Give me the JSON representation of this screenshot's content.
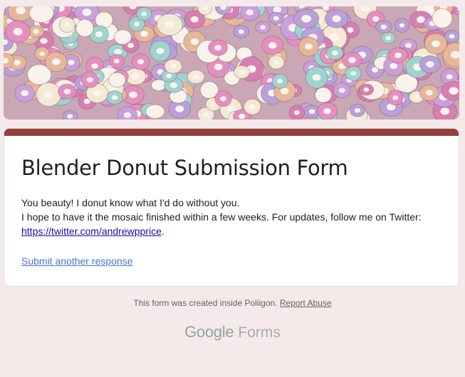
{
  "banner": {
    "alt": "donut banner",
    "colors": [
      "#e58fc0",
      "#c9a0dc",
      "#9ed3d0",
      "#f3ead5",
      "#e6b89a",
      "#d77fb0",
      "#b8a0d8",
      "#f8f2ea"
    ]
  },
  "form": {
    "accent_color": "#963e3e",
    "title": "Blender Donut Submission Form",
    "message_line1": "You beauty! I donut know what I'd do without you.",
    "message_line2": "I hope to have it the mosaic finished within a few weeks. For updates, follow me on Twitter:",
    "twitter_link": "https://twitter.com/andrewpprice",
    "twitter_link_suffix": ".",
    "submit_another": "Submit another response"
  },
  "footer": {
    "created_text": "This form was created inside Poliigon.",
    "report_abuse": "Report Abuse",
    "brand_google": "Google",
    "brand_forms": "Forms"
  }
}
